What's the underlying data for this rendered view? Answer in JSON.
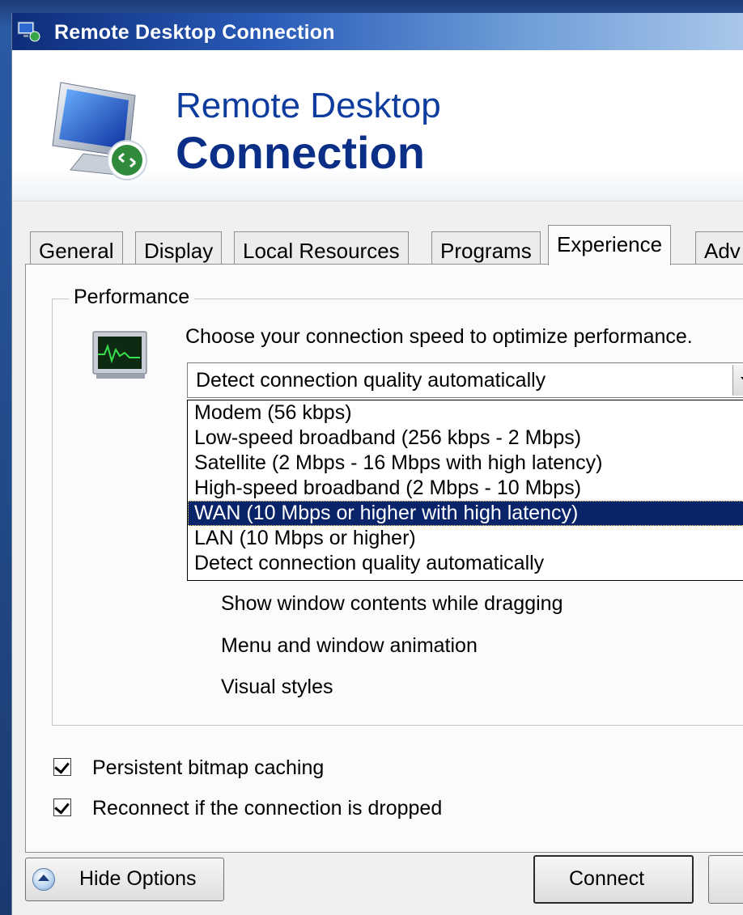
{
  "window": {
    "title": "Remote Desktop Connection"
  },
  "banner": {
    "line1": "Remote Desktop",
    "line2": "Connection"
  },
  "tabs": [
    {
      "label": "General"
    },
    {
      "label": "Display"
    },
    {
      "label": "Local Resources"
    },
    {
      "label": "Programs"
    },
    {
      "label": "Experience",
      "active": true
    },
    {
      "label": "Adv"
    }
  ],
  "performance": {
    "group_label": "Performance",
    "description": "Choose your connection speed to optimize performance.",
    "connection_speed": {
      "selected": "Detect connection quality automatically",
      "options": [
        "Modem (56 kbps)",
        "Low-speed broadband (256 kbps - 2 Mbps)",
        "Satellite (2 Mbps - 16 Mbps with high latency)",
        "High-speed broadband (2 Mbps - 10 Mbps)",
        "WAN (10 Mbps or higher with high latency)",
        "LAN (10 Mbps or higher)",
        "Detect connection quality automatically"
      ],
      "highlighted": "WAN (10 Mbps or higher with high latency)"
    },
    "features": [
      "Show window contents while dragging",
      "Menu and window animation",
      "Visual styles"
    ]
  },
  "checkboxes": [
    {
      "label": "Persistent bitmap caching",
      "checked": true
    },
    {
      "label": "Reconnect if the connection is dropped",
      "checked": true
    }
  ],
  "footer": {
    "hide_options": "Hide Options",
    "connect": "Connect"
  },
  "colors": {
    "title_bar": "#0d2d7a",
    "banner_text": "#0e3c9e",
    "selection": "#0a246a"
  },
  "icons": [
    "remote-desktop-icon",
    "monitor-connection-icon",
    "performance-monitor-icon",
    "dropdown-arrow-icon",
    "checkbox-check-icon",
    "collapse-up-icon"
  ]
}
